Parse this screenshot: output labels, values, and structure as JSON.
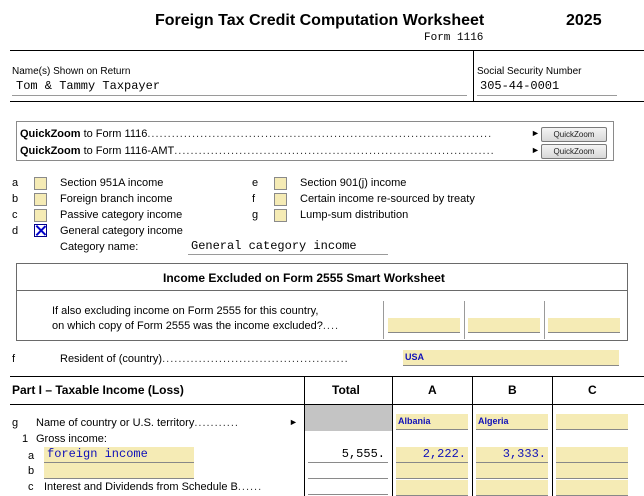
{
  "header": {
    "title": "Foreign Tax Credit Computation Worksheet",
    "year": "2025",
    "form": "Form 1116"
  },
  "taxpayer": {
    "name_label": "Name(s) Shown on Return",
    "name_value": "Tom & Tammy Taxpayer",
    "ssn_label": "Social Security Number",
    "ssn_value": "305-44-0001"
  },
  "quickzoom": {
    "row1_bold": "QuickZoom",
    "row1_text": " to Form 1116",
    "row2_bold": "QuickZoom",
    "row2_text": " to Form 1116-AMT",
    "button_label": "QuickZoom"
  },
  "categories": {
    "left": [
      {
        "letter": "a",
        "label": "Section 951A income",
        "checked": false
      },
      {
        "letter": "b",
        "label": "Foreign branch income",
        "checked": false
      },
      {
        "letter": "c",
        "label": "Passive category income",
        "checked": false
      },
      {
        "letter": "d",
        "label": "General category income",
        "checked": true
      }
    ],
    "right": [
      {
        "letter": "e",
        "label": "Section 901(j) income",
        "checked": false
      },
      {
        "letter": "f",
        "label": "Certain income re-sourced by treaty",
        "checked": false
      },
      {
        "letter": "g",
        "label": "Lump-sum distribution",
        "checked": false
      }
    ],
    "category_name_label": "Category name:",
    "category_name_value": "General category income"
  },
  "smart_worksheet": {
    "title": "Income Excluded on Form 2555 Smart Worksheet",
    "line1": "If also excluding income on Form 2555 for this country,",
    "line2": "on which copy of Form 2555 was the income excluded?"
  },
  "resident": {
    "letter": "f",
    "label": "Resident of (country)",
    "value": "USA"
  },
  "part1": {
    "title": "Part I – Taxable Income (Loss)",
    "col_total": "Total",
    "col_a": "A",
    "col_b": "B",
    "col_c": "C",
    "line_g_letter": "g",
    "line_g_label": "Name of country or U.S. territory",
    "country_a": "Albania",
    "country_b": "Algeria",
    "line1_num": "1",
    "line1_label": "Gross income:",
    "line_a_letter": "a",
    "line_a_desc": "foreign income",
    "line_a_total": "5,555.",
    "line_a_a": "2,222.",
    "line_a_b": "3,333.",
    "line_b_letter": "b",
    "line_c_letter": "c",
    "line_c_label": "Interest and Dividends from Schedule B"
  }
}
